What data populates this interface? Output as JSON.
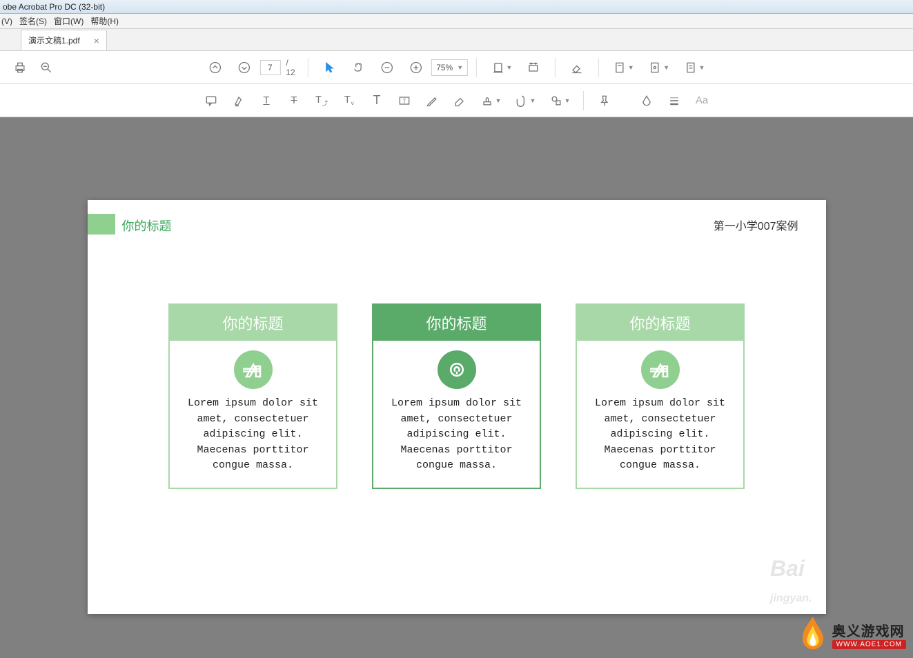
{
  "app": {
    "title": "obe Acrobat Pro DC (32-bit)"
  },
  "menu": {
    "view": "(V)",
    "sign": "签名(S)",
    "window": "窗口(W)",
    "help": "帮助(H)"
  },
  "tab": {
    "label": "演示文稿1.pdf"
  },
  "toolbar": {
    "page_current": "7",
    "page_total": "/ 12",
    "zoom": "75%"
  },
  "slide": {
    "title": "你的标题",
    "case": "第一小学007案例",
    "card1": {
      "title": "你的标题",
      "body": "Lorem ipsum dolor sit amet, consectetuer adipiscing elit. Maecenas porttitor congue massa."
    },
    "card2": {
      "title": "你的标题",
      "body": "Lorem ipsum dolor sit amet, consectetuer adipiscing elit. Maecenas porttitor congue massa."
    },
    "card3": {
      "title": "你的标题",
      "body": "Lorem ipsum dolor sit amet, consectetuer adipiscing elit. Maecenas porttitor congue massa."
    }
  },
  "watermark": {
    "text": "Bai",
    "sub": "jingyan."
  },
  "site": {
    "name": "奥义游戏网",
    "url": "WWW.AOE1.COM"
  }
}
